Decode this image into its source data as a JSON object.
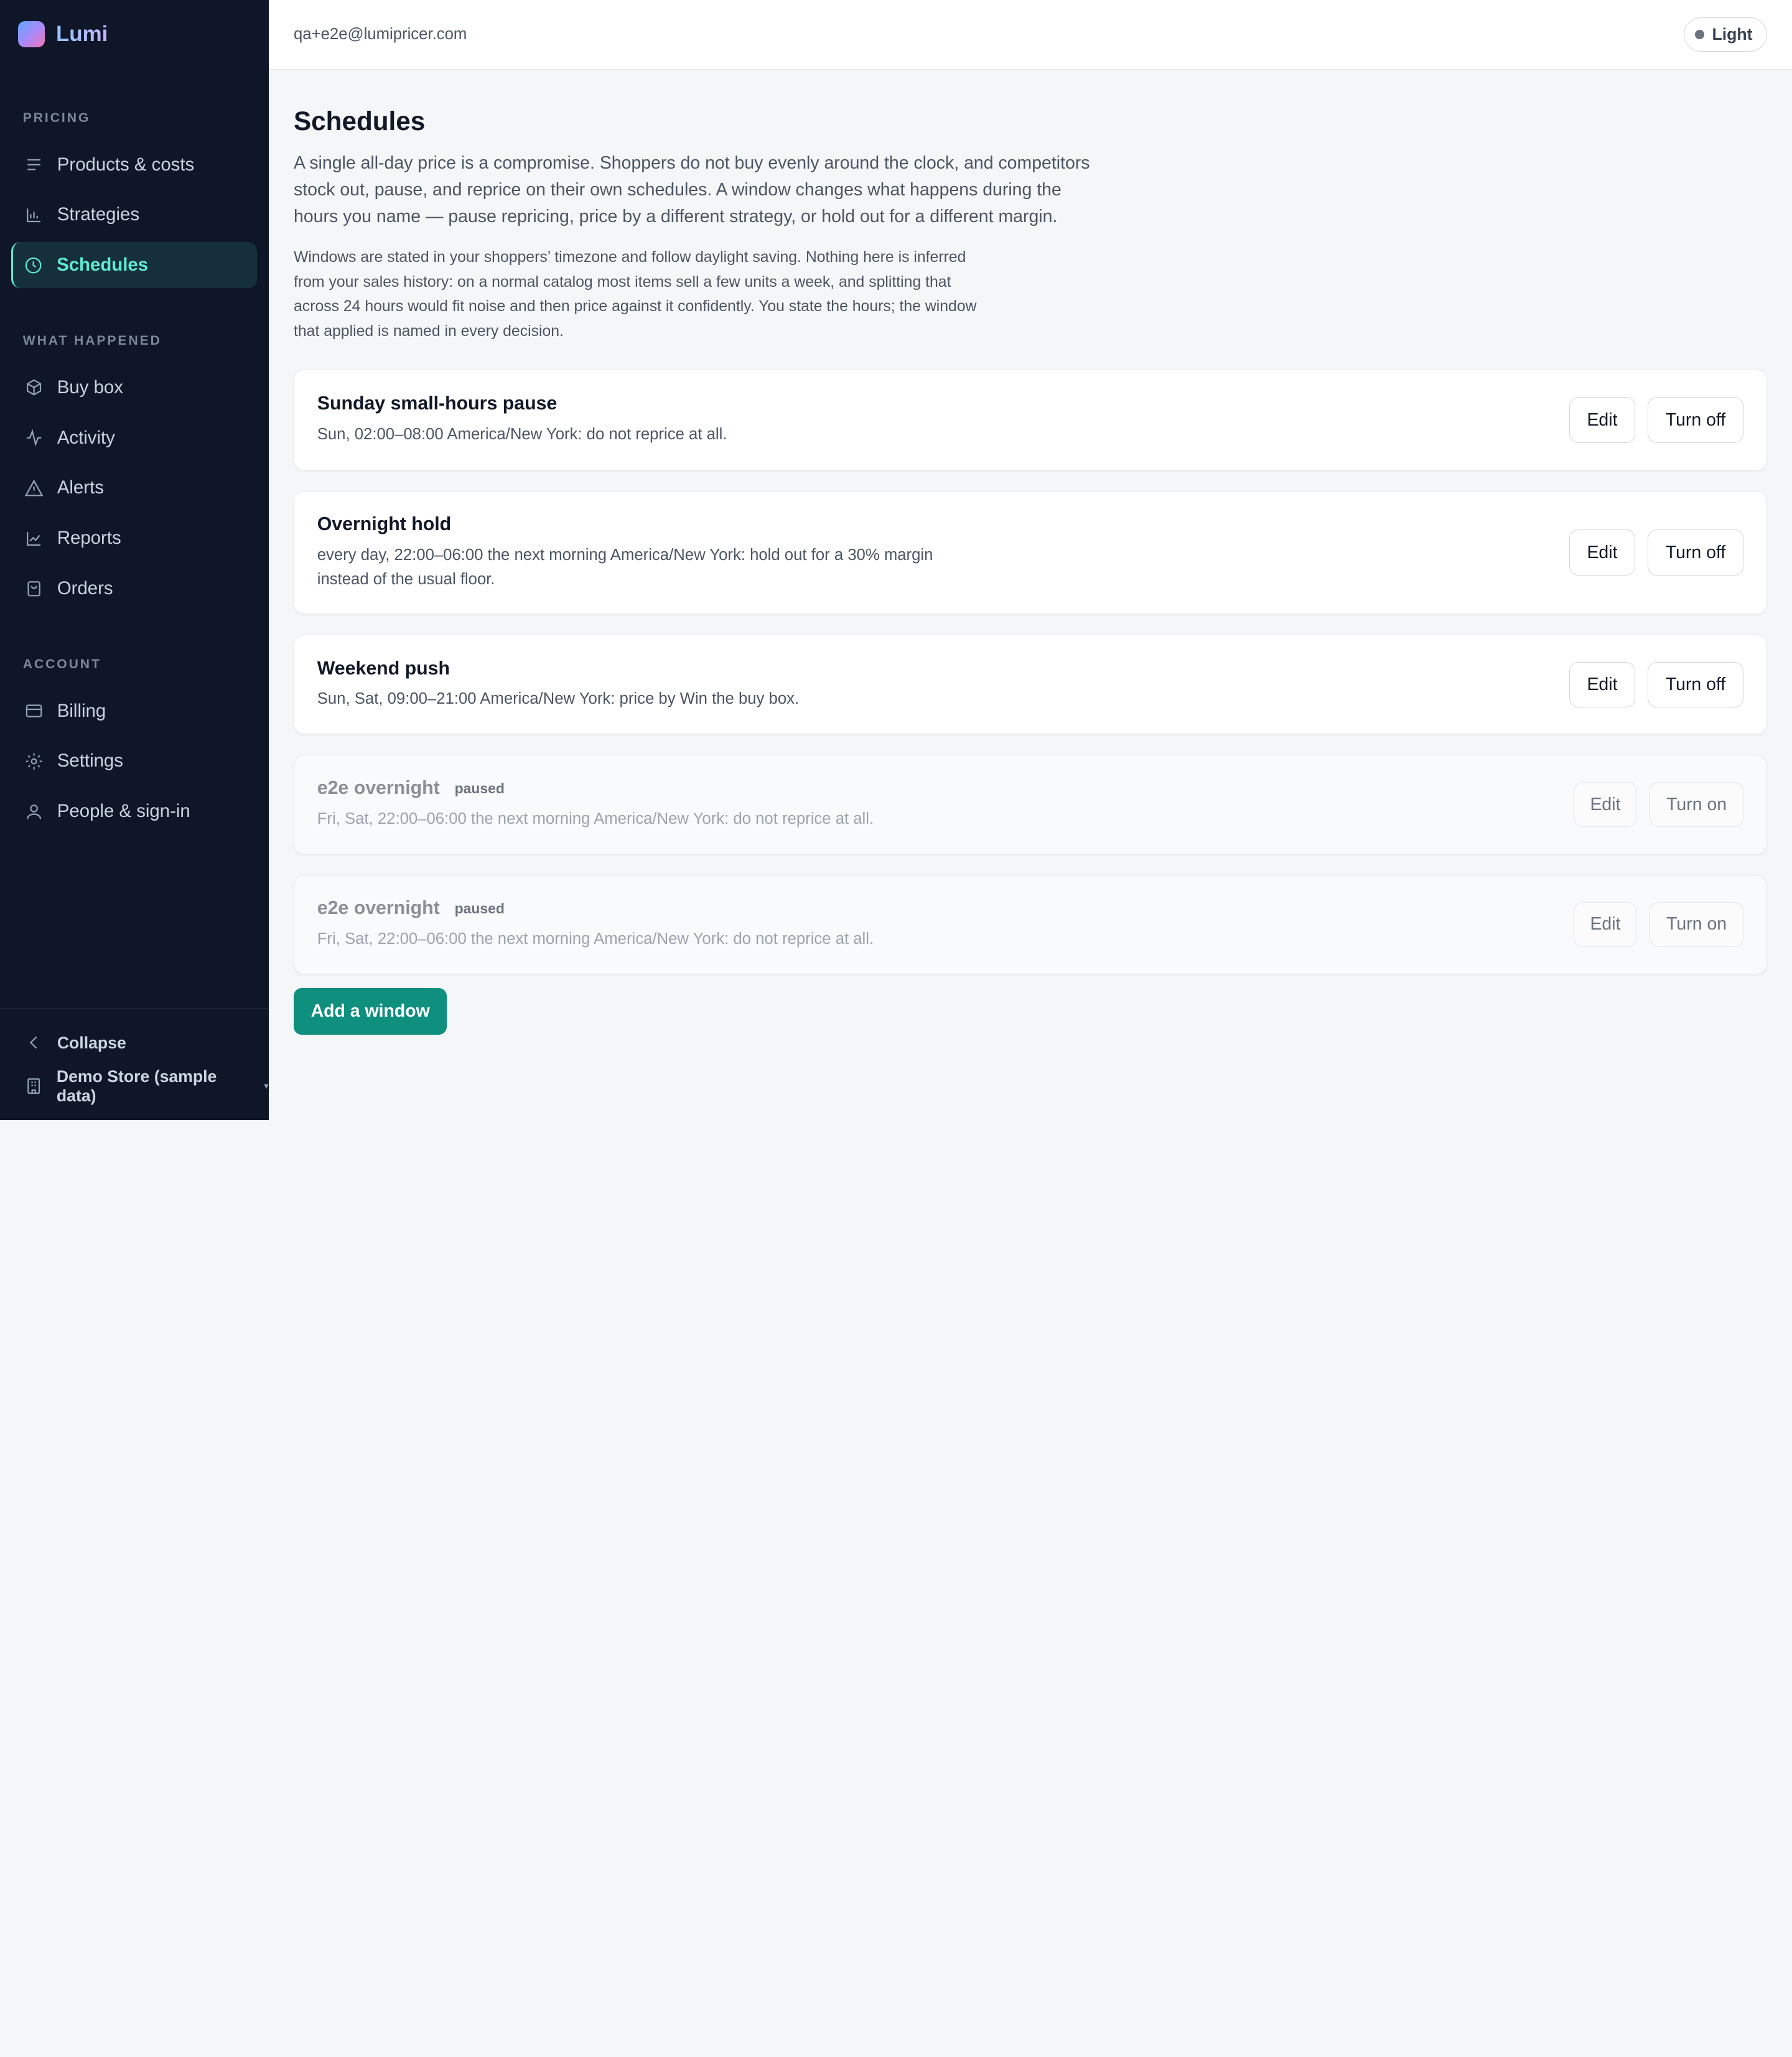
{
  "app": {
    "name": "Lumi"
  },
  "sidebar": {
    "sections": [
      {
        "label": "PRICING",
        "items": [
          {
            "label": "Products & costs",
            "icon": "list-icon"
          },
          {
            "label": "Strategies",
            "icon": "bar-chart-icon"
          },
          {
            "label": "Schedules",
            "icon": "clock-icon",
            "active": true
          }
        ]
      },
      {
        "label": "WHAT HAPPENED",
        "items": [
          {
            "label": "Buy box",
            "icon": "box-icon"
          },
          {
            "label": "Activity",
            "icon": "activity-icon"
          },
          {
            "label": "Alerts",
            "icon": "warning-icon"
          },
          {
            "label": "Reports",
            "icon": "line-chart-icon"
          },
          {
            "label": "Orders",
            "icon": "bag-icon"
          }
        ]
      },
      {
        "label": "ACCOUNT",
        "items": [
          {
            "label": "Billing",
            "icon": "card-icon"
          },
          {
            "label": "Settings",
            "icon": "gear-icon"
          },
          {
            "label": "People & sign-in",
            "icon": "user-icon"
          }
        ]
      }
    ],
    "footer": {
      "collapse_label": "Collapse",
      "store_label": "Demo Store (sample data)"
    }
  },
  "topbar": {
    "email": "qa+e2e@lumipricer.com",
    "theme_label": "Light"
  },
  "page": {
    "title": "Schedules",
    "lead": "A single all-day price is a compromise. Shoppers do not buy evenly around the clock, and competitors stock out, pause, and reprice on their own schedules. A window changes what happens during the hours you name — pause repricing, price by a different strategy, or hold out for a different margin.",
    "note": "Windows are stated in your shoppers’ timezone and follow daylight saving. Nothing here is inferred from your sales history: on a normal catalog most items sell a few units a week, and splitting that across 24 hours would fit noise and then price against it confidently. You state the hours; the window that applied is named in every decision."
  },
  "windows": [
    {
      "title": "Sunday small-hours pause",
      "badge": "",
      "desc": "Sun, 02:00–08:00 America/New York: do not reprice at all.",
      "edit_label": "Edit",
      "toggle_label": "Turn off",
      "paused": false
    },
    {
      "title": "Overnight hold",
      "badge": "",
      "desc": "every day, 22:00–06:00 the next morning America/New York: hold out for a 30% margin instead of the usual floor.",
      "edit_label": "Edit",
      "toggle_label": "Turn off",
      "paused": false
    },
    {
      "title": "Weekend push",
      "badge": "",
      "desc": "Sun, Sat, 09:00–21:00 America/New York: price by Win the buy box.",
      "edit_label": "Edit",
      "toggle_label": "Turn off",
      "paused": false
    },
    {
      "title": "e2e overnight",
      "badge": "paused",
      "desc": "Fri, Sat, 22:00–06:00 the next morning America/New York: do not reprice at all.",
      "edit_label": "Edit",
      "toggle_label": "Turn on",
      "paused": true
    },
    {
      "title": "e2e overnight",
      "badge": "paused",
      "desc": "Fri, Sat, 22:00–06:00 the next morning America/New York: do not reprice at all.",
      "edit_label": "Edit",
      "toggle_label": "Turn on",
      "paused": true
    }
  ],
  "add_button_label": "Add a window",
  "colors": {
    "sidebar_bg": "#0e1628",
    "accent": "#5eead4",
    "primary": "#0f8f7e"
  }
}
